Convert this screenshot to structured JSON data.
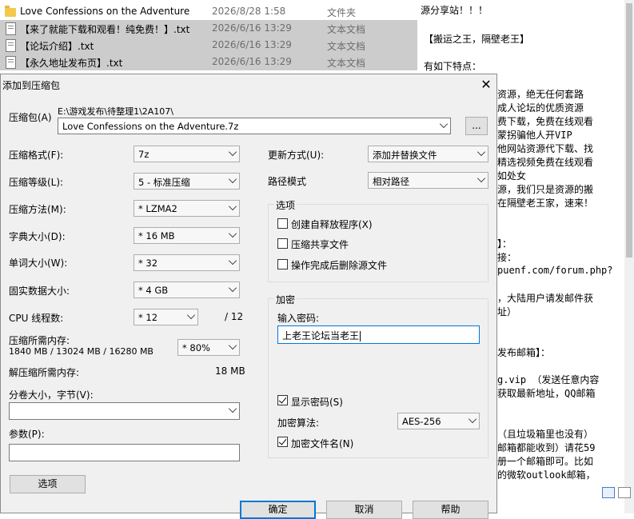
{
  "file_list": [
    {
      "name": "Love Confessions on the Adventure",
      "date": "2026/8/28 1:58",
      "type": "文件夹",
      "icon": "folder-icon",
      "selected": false
    },
    {
      "name": "【来了就能下载和观看！纯免费！】.txt",
      "date": "2026/6/16 13:29",
      "type": "文本文档",
      "icon": "text-file-icon",
      "selected": true
    },
    {
      "name": "【论坛介绍】.txt",
      "date": "2026/6/16 13:29",
      "type": "文本文档",
      "icon": "text-file-icon",
      "selected": true
    },
    {
      "name": "【永久地址发布页】.txt",
      "date": "2026/6/16 13:29",
      "type": "文本文档",
      "icon": "text-file-icon",
      "selected": true
    }
  ],
  "text_pane": {
    "lines": [
      "源分享站！！！",
      "【搬运之王，隔壁老王】",
      "有如下特点：",
      "资源，绝无任何套路",
      "成人论坛的优质资源",
      "费下载，免费在线观看",
      "蒙拐骗他人开VIP",
      "他网站资源代下载、找",
      "精选视频免费在线观看",
      "如处女",
      "源，我们只是资源的搬",
      "在隔壁老王家，速来！",
      "】：",
      "接：",
      "puenf.com/forum.php?",
      "，大陆用户请发邮件获",
      "址）",
      "发布邮箱】：",
      "g.vip  （发送任意内容",
      "获取最新地址，QQ邮箱",
      "（且垃圾箱里也没有）",
      "邮箱都能收到）请花59",
      "册一个邮箱即可。比如",
      "的微软outlook邮箱，"
    ]
  },
  "dialog": {
    "title": "添加到压缩包",
    "archive_label": "压缩包(A)",
    "archive_path": "E:\\游戏发布\\待整理1\\2A107\\",
    "archive_name": "Love Confessions on the Adventure.7z",
    "browse_button": "...",
    "format": {
      "label": "压缩格式(F):",
      "value": "7z"
    },
    "level": {
      "label": "压缩等级(L):",
      "value": "5 - 标准压缩"
    },
    "method": {
      "label": "压缩方法(M):",
      "value": "* LZMA2"
    },
    "dict": {
      "label": "字典大小(D):",
      "value": "* 16 MB"
    },
    "word": {
      "label": "单词大小(W):",
      "value": "* 32"
    },
    "solid": {
      "label": "固实数据大小:",
      "value": "* 4 GB"
    },
    "threads": {
      "label": "CPU 线程数:",
      "value": "* 12",
      "max": "/ 12"
    },
    "mem_compress": {
      "label": "压缩所需内存:",
      "value": "1840 MB / 13024 MB / 16280 MB",
      "percent": "* 80%"
    },
    "mem_decompress": {
      "label": "解压缩所需内存:",
      "value": "18 MB"
    },
    "split": {
      "label": "分卷大小，字节(V):",
      "value": ""
    },
    "params": {
      "label": "参数(P):",
      "value": ""
    },
    "options_button": "选项",
    "update_mode": {
      "label": "更新方式(U):",
      "value": "添加并替换文件"
    },
    "path_mode": {
      "label": "路径模式",
      "value": "相对路径"
    },
    "options_group": {
      "title": "选项",
      "items": [
        {
          "label": "创建自释放程序(X)",
          "checked": false
        },
        {
          "label": "压缩共享文件",
          "checked": false
        },
        {
          "label": "操作完成后删除源文件",
          "checked": false
        }
      ]
    },
    "encryption": {
      "title": "加密",
      "password_label": "输入密码:",
      "password_value": "上老王论坛当老王",
      "show_password": {
        "label": "显示密码(S)",
        "checked": true
      },
      "method_label": "加密算法:",
      "method_value": "AES-256",
      "encrypt_names": {
        "label": "加密文件名(N)",
        "checked": true
      }
    },
    "buttons": {
      "ok": "确定",
      "cancel": "取消",
      "help": "帮助"
    }
  }
}
